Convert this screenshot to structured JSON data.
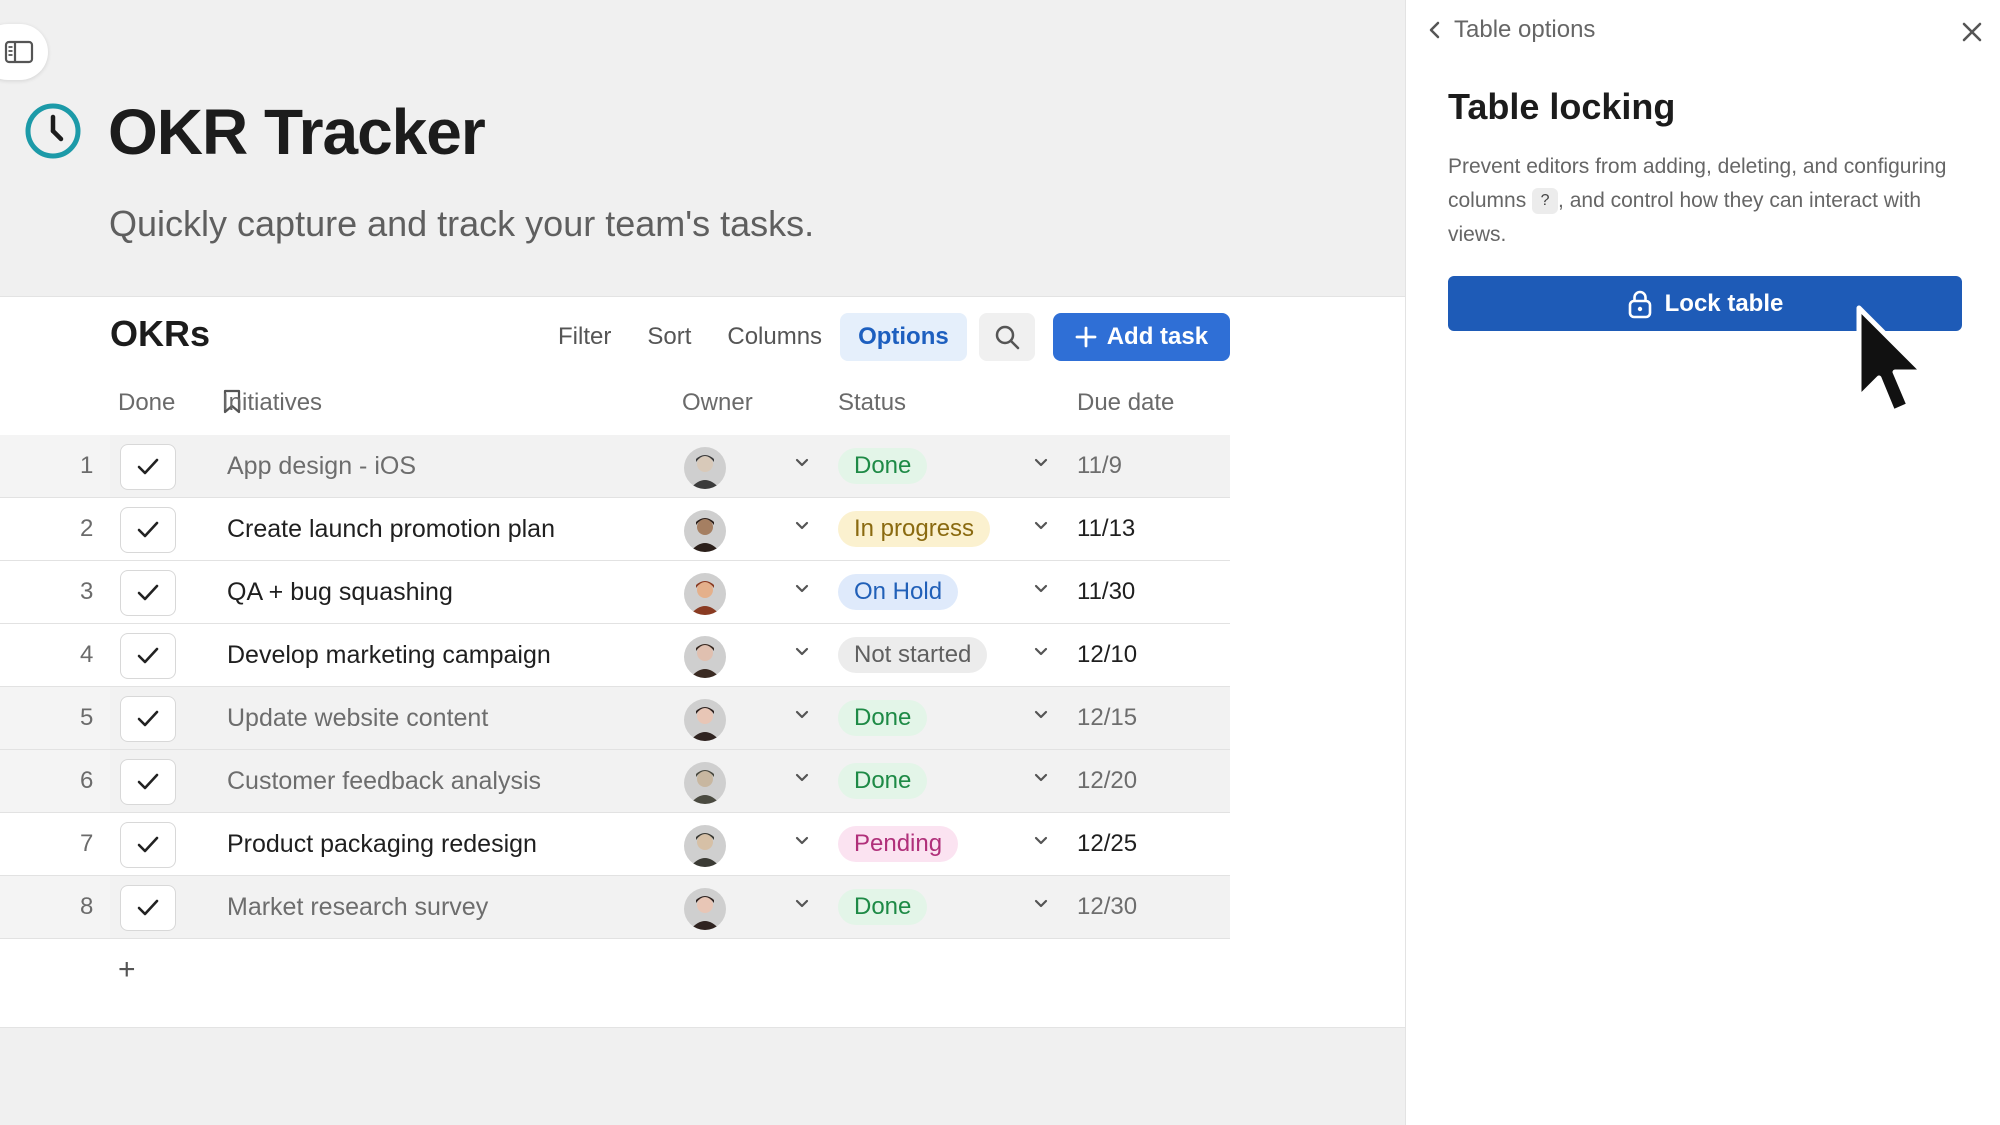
{
  "page": {
    "title": "OKR Tracker",
    "subtitle": "Quickly capture and track your team's tasks."
  },
  "table": {
    "title": "OKRs",
    "toolbar": {
      "filter": "Filter",
      "sort": "Sort",
      "columns": "Columns",
      "options": "Options",
      "add_task": "Add task"
    },
    "headers": {
      "done": "Done",
      "initiatives": "Initiatives",
      "owner": "Owner",
      "status": "Status",
      "due_date": "Due date"
    },
    "rows": [
      {
        "num": "1",
        "task": "App design - iOS",
        "status": "Done",
        "due": "11/9"
      },
      {
        "num": "2",
        "task": "Create launch promotion plan",
        "status": "In progress",
        "due": "11/13"
      },
      {
        "num": "3",
        "task": "QA + bug squashing",
        "status": "On Hold",
        "due": "11/30"
      },
      {
        "num": "4",
        "task": "Develop marketing campaign",
        "status": "Not started",
        "due": "12/10"
      },
      {
        "num": "5",
        "task": "Update website content",
        "status": "Done",
        "due": "12/15"
      },
      {
        "num": "6",
        "task": "Customer feedback analysis",
        "status": "Done",
        "due": "12/20"
      },
      {
        "num": "7",
        "task": "Product packaging redesign",
        "status": "Pending",
        "due": "12/25"
      },
      {
        "num": "8",
        "task": "Market research survey",
        "status": "Done",
        "due": "12/30"
      }
    ],
    "add_row": "+"
  },
  "status_colors": {
    "Done": {
      "bg": "#e3f5e8",
      "fg": "#1e8a46"
    },
    "In progress": {
      "bg": "#fbf1cf",
      "fg": "#8a6a10"
    },
    "On Hold": {
      "bg": "#dfeafb",
      "fg": "#2160b8"
    },
    "Not started": {
      "bg": "#ececec",
      "fg": "#5f5f5f"
    },
    "Pending": {
      "bg": "#fbe3f1",
      "fg": "#b0307a"
    }
  },
  "panel": {
    "back_label": "Table options",
    "heading": "Table locking",
    "desc_part1": "Prevent editors from adding, deleting, and configuring columns",
    "help": "?",
    "desc_part2": ", and control how they can interact with views.",
    "lock_button": "Lock table"
  },
  "icons": {
    "sidebar_toggle": "sidebar-icon",
    "page": "clock-icon",
    "search": "search-icon",
    "bookmark": "bookmark-icon",
    "lock": "lock-icon",
    "close": "close-icon",
    "back": "chevron-left-icon"
  },
  "colors": {
    "accent": "#2f6fd6",
    "lock_button": "#1e5bb7",
    "page_icon": "#1c9aa8"
  }
}
